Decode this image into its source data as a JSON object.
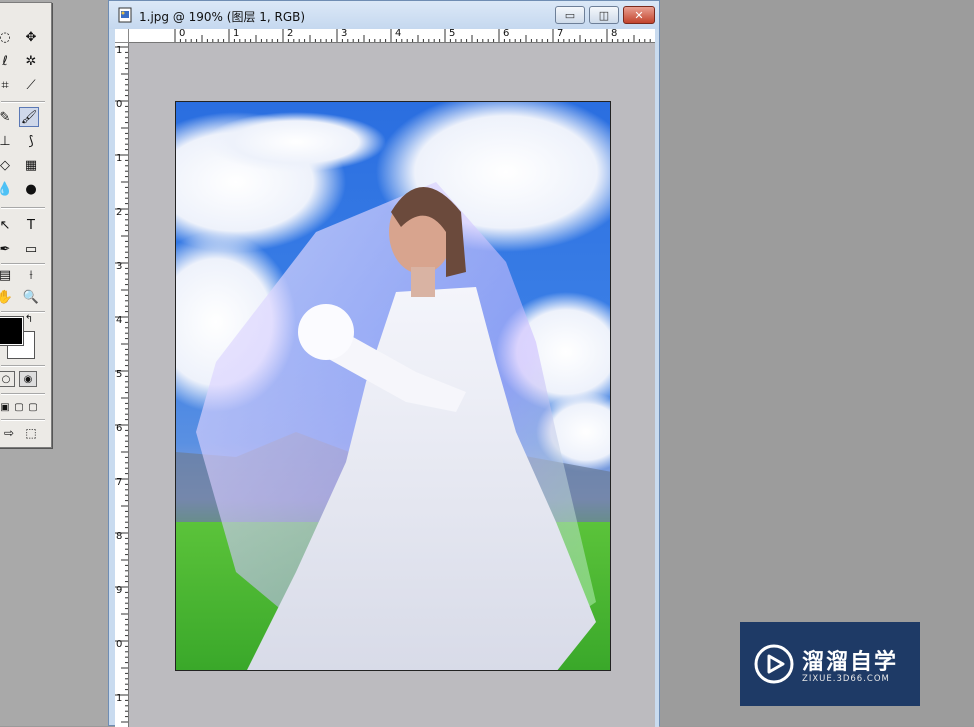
{
  "document": {
    "title": "1.jpg @ 190% (图层 1, RGB)",
    "buttons": {
      "minimize": "▭",
      "maximize": "◫",
      "close": "✕"
    }
  },
  "rulers": {
    "top": [
      "0",
      "1",
      "2",
      "3",
      "4",
      "5",
      "6",
      "7",
      "8"
    ],
    "left": [
      "1",
      "0",
      "1",
      "2",
      "3",
      "4",
      "5",
      "6",
      "7",
      "8",
      "9",
      "0",
      "1"
    ]
  },
  "toolbox": {
    "tools": [
      {
        "icon": "marquee-icon",
        "glyph": "◌"
      },
      {
        "icon": "move-icon",
        "glyph": "✥"
      },
      {
        "icon": "lasso-icon",
        "glyph": "ℓ"
      },
      {
        "icon": "magic-wand-icon",
        "glyph": "✲"
      },
      {
        "icon": "crop-icon",
        "glyph": "⌗"
      },
      {
        "icon": "slice-icon",
        "glyph": "⟋"
      },
      {
        "icon": "healing-brush-icon",
        "glyph": "✎"
      },
      {
        "icon": "brush-icon",
        "glyph": "🖌"
      },
      {
        "icon": "stamp-icon",
        "glyph": "⊥"
      },
      {
        "icon": "history-brush-icon",
        "glyph": "⟆"
      },
      {
        "icon": "eraser-icon",
        "glyph": "◇"
      },
      {
        "icon": "gradient-icon",
        "glyph": "▦"
      },
      {
        "icon": "blur-icon",
        "glyph": "💧"
      },
      {
        "icon": "dodge-icon",
        "glyph": "●"
      },
      {
        "icon": "path-select-icon",
        "glyph": "↖"
      },
      {
        "icon": "type-icon",
        "glyph": "T"
      },
      {
        "icon": "pen-icon",
        "glyph": "✒"
      },
      {
        "icon": "shape-icon",
        "glyph": "▭"
      },
      {
        "icon": "notes-icon",
        "glyph": "▤"
      },
      {
        "icon": "eyedropper-icon",
        "glyph": "⟊"
      },
      {
        "icon": "hand-icon",
        "glyph": "✋"
      },
      {
        "icon": "zoom-icon",
        "glyph": "🔍"
      }
    ],
    "foreground_color": "#000000",
    "background_color": "#ffffff"
  },
  "watermark": {
    "text": "溜溜自学",
    "subtext": "ZIXUE.3D66.COM"
  }
}
